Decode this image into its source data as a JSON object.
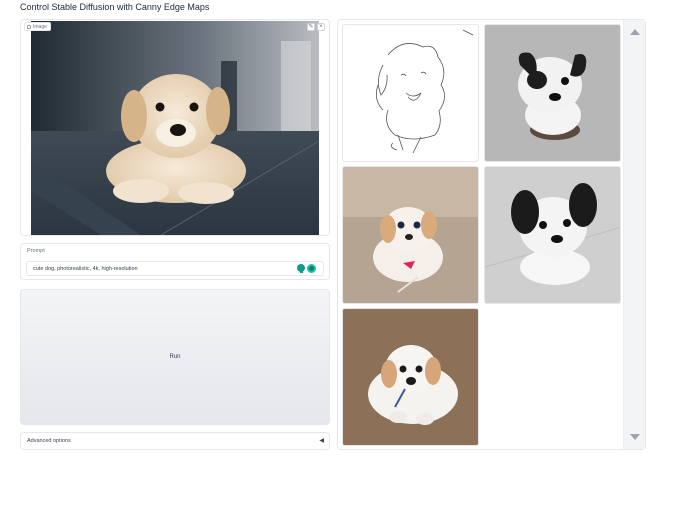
{
  "page": {
    "title": "Control Stable Diffusion with Canny Edge Maps"
  },
  "image_input": {
    "label": "Image",
    "image_icon": "image-icon",
    "edit_icon": "pencil-icon",
    "clear_icon": "close-icon",
    "edit_glyph": "✎",
    "clear_glyph": "×"
  },
  "prompt": {
    "label": "Prompt",
    "value": "cute dog, photorealistic, 4k, high-resolution"
  },
  "run": {
    "label": "Run"
  },
  "advanced": {
    "label": "Advanced options",
    "arrow": "◀"
  },
  "gallery": {
    "items": [
      {
        "name": "canny-edge-map"
      },
      {
        "name": "generated-dog-1"
      },
      {
        "name": "generated-dog-2"
      },
      {
        "name": "generated-dog-3"
      },
      {
        "name": "generated-dog-4"
      }
    ]
  },
  "colors": {
    "accent": "#0f9d8a",
    "border": "#e5e7eb",
    "button_bg": "#eceef1"
  }
}
